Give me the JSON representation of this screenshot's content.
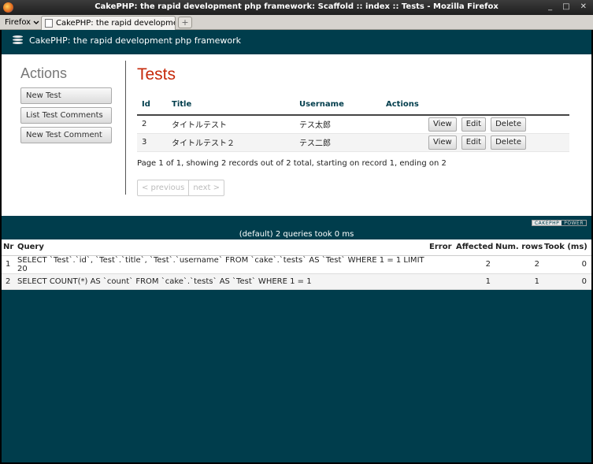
{
  "window": {
    "title": "CakePHP: the rapid development php framework: Scaffold :: index :: Tests - Mozilla Firefox",
    "controls": [
      "_",
      "□",
      "✕"
    ]
  },
  "browser": {
    "menu_label": "Firefox",
    "tab_label": "CakePHP: the rapid development p...",
    "new_tab_label": "+"
  },
  "header": {
    "site_title": "CakePHP: the rapid development php framework"
  },
  "actions": {
    "heading": "Actions",
    "items": [
      "New Test",
      "List Test Comments",
      "New Test Comment"
    ]
  },
  "main": {
    "title": "Tests",
    "columns": [
      "Id",
      "Title",
      "Username",
      "Actions"
    ],
    "rows": [
      {
        "id": "2",
        "title": "タイトルテスト",
        "username": "テス太郎"
      },
      {
        "id": "3",
        "title": "タイトルテスト２",
        "username": "テス二郎"
      }
    ],
    "row_actions": [
      "View",
      "Edit",
      "Delete"
    ],
    "paging_info": "Page 1 of 1, showing 2 records out of 2 total, starting on record 1, ending on 2",
    "prev_label": "< previous",
    "next_label": "next >"
  },
  "footer": {
    "powered_a": "CAKEPHP",
    "powered_b": "POWER"
  },
  "sql": {
    "summary": "(default) 2 queries took 0 ms",
    "columns": [
      "Nr",
      "Query",
      "Error",
      "Affected",
      "Num. rows",
      "Took (ms)"
    ],
    "rows": [
      {
        "nr": "1",
        "query": "SELECT `Test`.`id`, `Test`.`title`, `Test`.`username` FROM `cake`.`tests` AS `Test` WHERE 1 = 1 LIMIT 20",
        "error": "",
        "affected": "2",
        "num_rows": "2",
        "took": "0"
      },
      {
        "nr": "2",
        "query": "SELECT COUNT(*) AS `count` FROM `cake`.`tests` AS `Test` WHERE 1 = 1",
        "error": "",
        "affected": "1",
        "num_rows": "1",
        "took": "0"
      }
    ]
  }
}
